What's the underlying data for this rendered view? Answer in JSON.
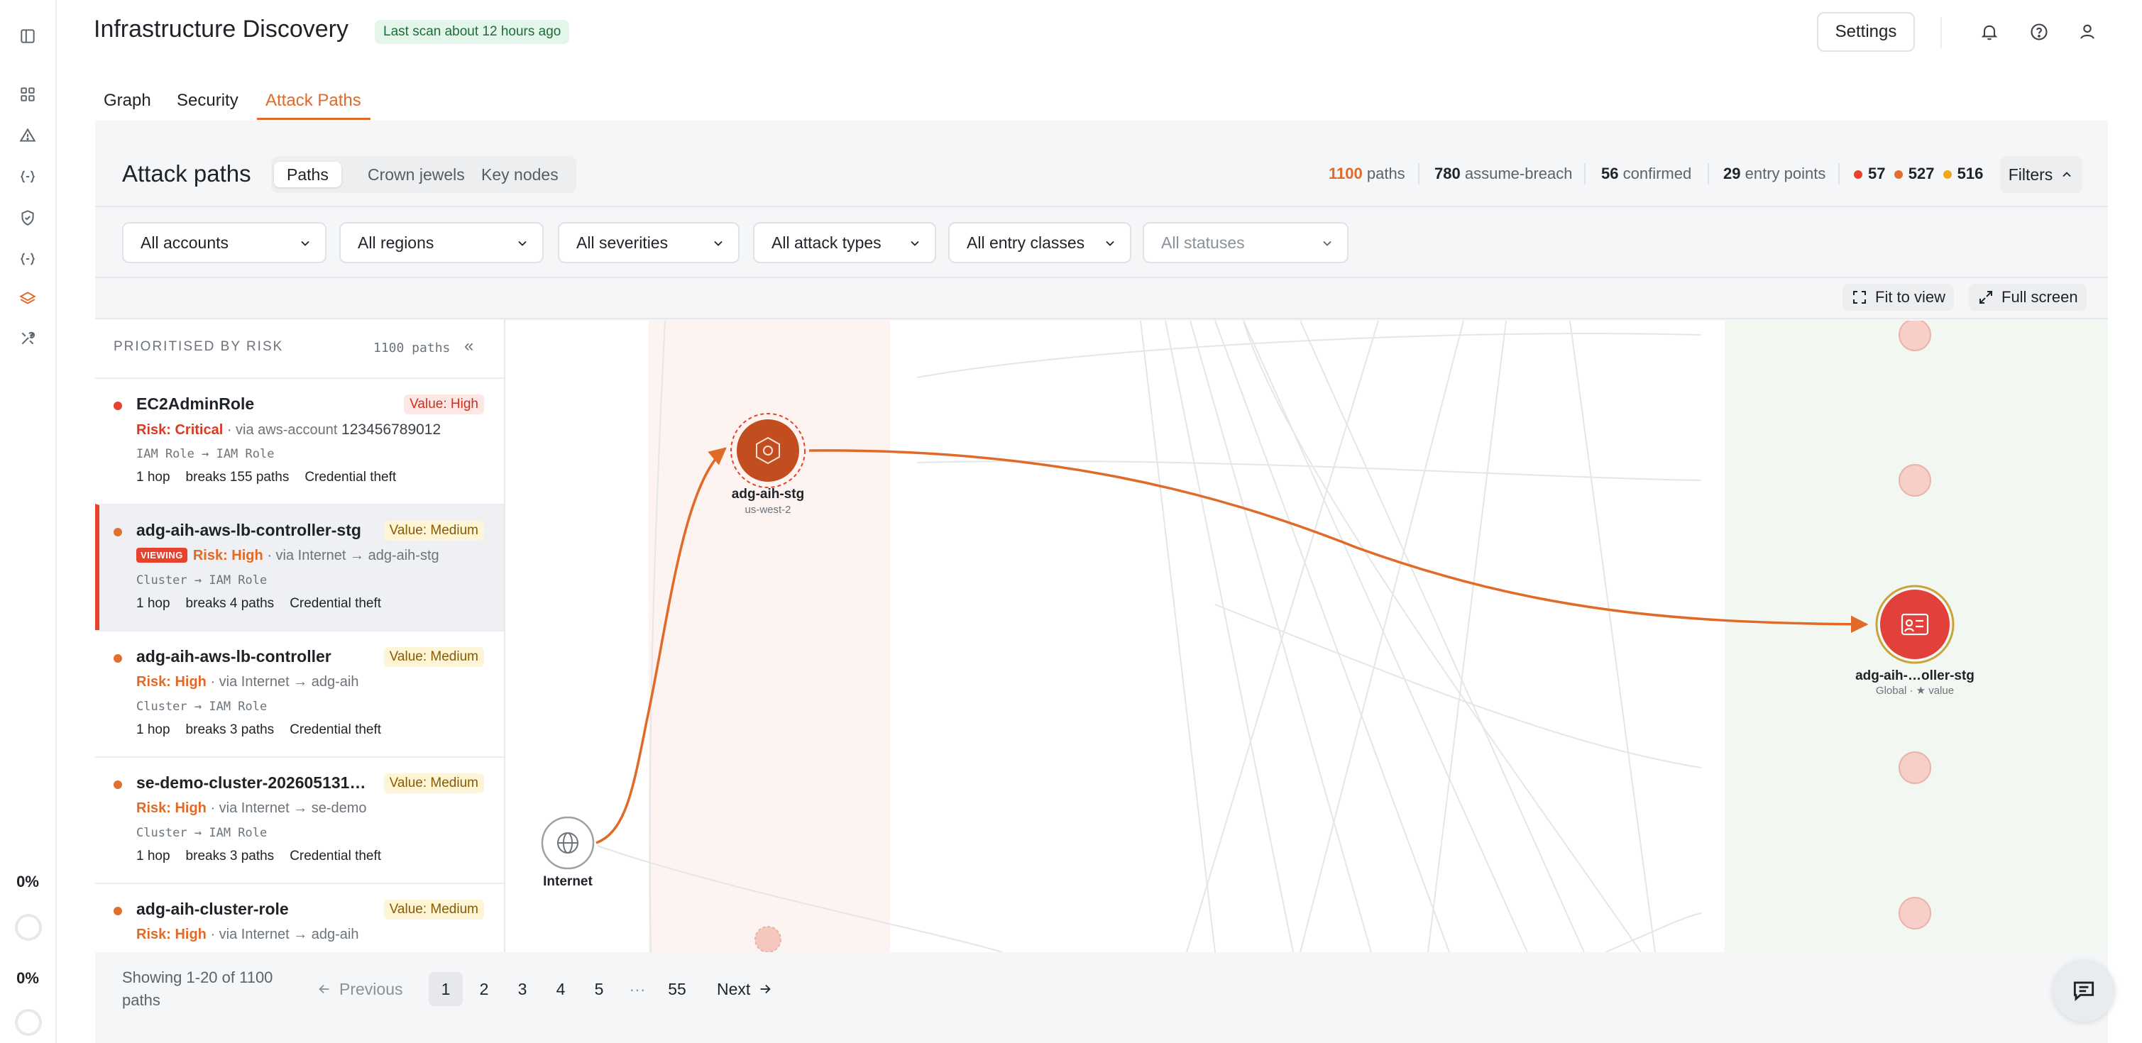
{
  "app": {
    "title": "Infrastructure Discovery",
    "scan_badge": "Last scan about 12 hours ago",
    "settings_label": "Settings"
  },
  "rail": {
    "icons": [
      "sidebar-toggle-icon",
      "dashboard-icon",
      "alert-icon",
      "code-braces-icon",
      "shield-icon",
      "code-braces-icon",
      "layers-icon",
      "tools-icon"
    ],
    "progress": [
      {
        "label": "0%",
        "value": 0
      },
      {
        "label": "0%",
        "value": 0
      }
    ]
  },
  "tabs": [
    {
      "label": "Graph",
      "active": false
    },
    {
      "label": "Security",
      "active": false
    },
    {
      "label": "Attack Paths",
      "active": true
    }
  ],
  "attack_paths": {
    "title": "Attack paths",
    "segments": [
      {
        "label": "Paths",
        "active": true
      },
      {
        "label": "Crown jewels",
        "active": false
      },
      {
        "label": "Key nodes",
        "active": false
      }
    ],
    "stats": {
      "paths_count": "1100",
      "paths_label": "paths",
      "assume_count": "780",
      "assume_label": "assume-breach",
      "confirmed_count": "56",
      "confirmed_label": "confirmed",
      "entry_count": "29",
      "entry_label": "entry points",
      "sev_critical": "57",
      "sev_high": "527",
      "sev_medium": "516"
    },
    "filters_label": "Filters"
  },
  "dropdowns": [
    {
      "label": "All accounts"
    },
    {
      "label": "All regions"
    },
    {
      "label": "All severities"
    },
    {
      "label": "All attack types"
    },
    {
      "label": "All entry classes"
    },
    {
      "label": "All statuses"
    }
  ],
  "canvas_controls": {
    "fit_label": "Fit to view",
    "fullscreen_label": "Full screen"
  },
  "list": {
    "header": "PRIORITISED BY RISK",
    "count": "1100 paths",
    "collapse": "«",
    "items": [
      {
        "name": "EC2AdminRole",
        "value": "Value: High",
        "risk": "Risk: Critical",
        "via": "· via aws-account",
        "account": "123456789012",
        "type": "IAM Role → IAM Role",
        "hop": "1 hop",
        "breaks": "breaks 155 paths",
        "attack": "Credential theft"
      },
      {
        "name": "adg-aih-aws-lb-controller-stg",
        "value": "Value: Medium",
        "badge": "VIEWING",
        "risk": "Risk: High",
        "via": "· via Internet → adg-aih-stg",
        "type": "Cluster → IAM Role",
        "hop": "1 hop",
        "breaks": "breaks 4 paths",
        "attack": "Credential theft"
      },
      {
        "name": "adg-aih-aws-lb-controller",
        "value": "Value: Medium",
        "risk": "Risk: High",
        "via": "· via Internet → adg-aih",
        "type": "Cluster → IAM Role",
        "hop": "1 hop",
        "breaks": "breaks 3 paths",
        "attack": "Credential theft"
      },
      {
        "name": "se-demo-cluster-202605131…",
        "value": "Value: Medium",
        "risk": "Risk: High",
        "via": "· via Internet → se-demo",
        "type": "Cluster → IAM Role",
        "hop": "1 hop",
        "breaks": "breaks 3 paths",
        "attack": "Credential theft"
      },
      {
        "name": "adg-aih-cluster-role",
        "value": "Value: Medium",
        "risk": "Risk: High",
        "via": "· via Internet → adg-aih"
      }
    ]
  },
  "graph": {
    "entry_node": {
      "label": "Internet"
    },
    "cluster_node": {
      "label": "adg-aih-stg",
      "sub": "us-west-2"
    },
    "target_node": {
      "label": "adg-aih-…oller-stg",
      "sub": "Global · ★ value"
    }
  },
  "pagination": {
    "showing": "Showing 1-20 of 1100 paths",
    "previous": "Previous",
    "pages": [
      "1",
      "2",
      "3",
      "4",
      "5"
    ],
    "ellipsis": "···",
    "last": "55",
    "next": "Next",
    "current": "1"
  },
  "colors": {
    "accent": "#e06a28",
    "critical": "#e8412c",
    "high": "#e0702f",
    "medium": "#f0a81c"
  }
}
